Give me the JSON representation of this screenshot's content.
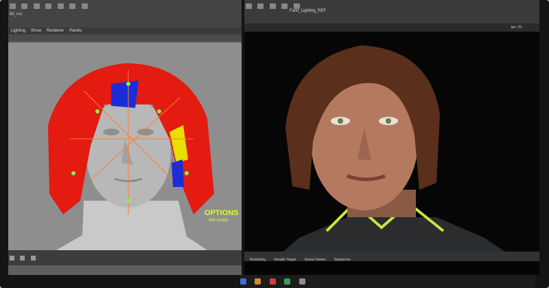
{
  "left_app": {
    "tab_label": "Bil_rov",
    "menus": [
      "Lighting",
      "Show",
      "Renderer",
      "Panels"
    ],
    "watermark_line1": "OPTIONS",
    "watermark_line2": "Will multipl"
  },
  "right_app": {
    "file_title": "Face_Lighting_REF",
    "status_text": "fps: 29",
    "footer_items": [
      "Rendering",
      "Render Target",
      "Scene Viewer",
      "Sequencer"
    ]
  },
  "colors": {
    "hair_red": "#e31b10",
    "highlight_yellow": "#d7ff33",
    "neutral_gray": "#9a9a9a"
  }
}
